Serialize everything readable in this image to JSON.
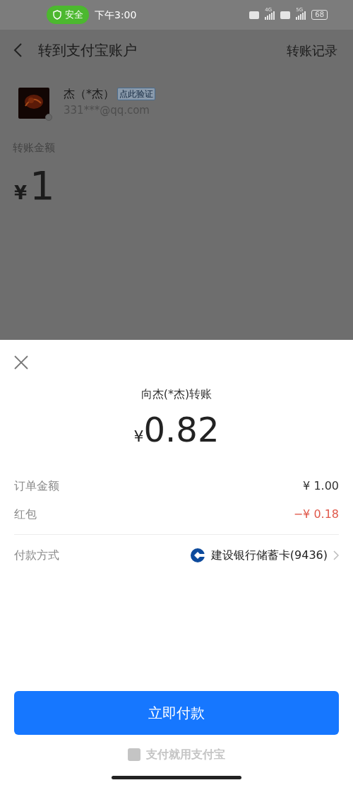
{
  "status_bar": {
    "security_badge": "安全",
    "time": "下午3:00",
    "networks": [
      "4G",
      "5G"
    ],
    "battery": "68"
  },
  "header": {
    "title": "转到支付宝账户",
    "action": "转账记录"
  },
  "recipient": {
    "name": "杰（*杰）",
    "verify_tag": "点此验证",
    "account": "331***@qq.com"
  },
  "amount_section": {
    "label": "转账金额",
    "currency": "¥",
    "amount": "1"
  },
  "payment_sheet": {
    "title": "向杰(*杰)转账",
    "currency": "¥",
    "amount": "0.82",
    "rows": [
      {
        "label": "订单金额",
        "value": "¥ 1.00",
        "kind": "normal"
      },
      {
        "label": "红包",
        "value": "−¥ 0.18",
        "kind": "discount"
      }
    ],
    "method": {
      "label": "付款方式",
      "value": "建设银行储蓄卡(9436)"
    },
    "pay_button": "立即付款",
    "footer": "支付就用支付宝"
  }
}
